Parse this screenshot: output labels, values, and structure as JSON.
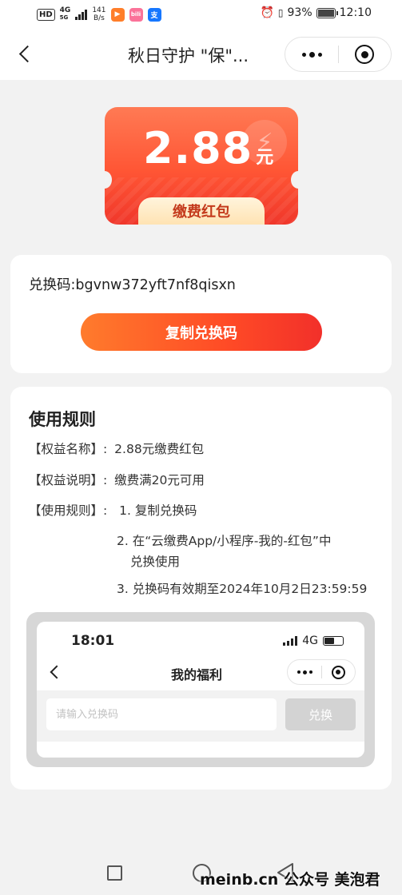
{
  "status_bar": {
    "hd": "HD",
    "network_type": "4G",
    "network_sub": "5G",
    "speed_value": "141",
    "speed_unit": "B/s",
    "apps": [
      {
        "name": "video-app",
        "glyph": "▶",
        "color": "#ff7e2a"
      },
      {
        "name": "bilibili-app",
        "glyph": "bili",
        "color": "#fb7299"
      },
      {
        "name": "alipay-app",
        "glyph": "支",
        "color": "#1677ff"
      }
    ],
    "battery_percent": "93%",
    "time": "12:10"
  },
  "nav": {
    "title": "秋日守护 \"保\"..."
  },
  "coupon": {
    "amount": "2.88",
    "unit": "元",
    "tag": "缴费红包",
    "emblem": "⚡"
  },
  "code_card": {
    "code_text": "兑换码:bgvnw372yft7nf8qisxn",
    "copy_button": "复制兑换码"
  },
  "rules": {
    "title": "使用规则",
    "rows": [
      {
        "label": "【权益名称】:",
        "value": "2.88元缴费红包"
      },
      {
        "label": "【权益说明】:",
        "value": "缴费满20元可用"
      },
      {
        "label": "【使用规则】:",
        "value": "1. 复制兑换码"
      }
    ],
    "steps": [
      "2. 在“云缴费App/小程序-我的-红包”中",
      "兑换使用",
      "3. 兑换码有效期至2024年10月2日23:59:59"
    ]
  },
  "mini_screen": {
    "time": "18:01",
    "network": "4G",
    "title": "我的福利",
    "input_placeholder": "请输入兑换码",
    "redeem_button": "兑换"
  },
  "watermark": "meinb.cn 公众号 美泡君"
}
